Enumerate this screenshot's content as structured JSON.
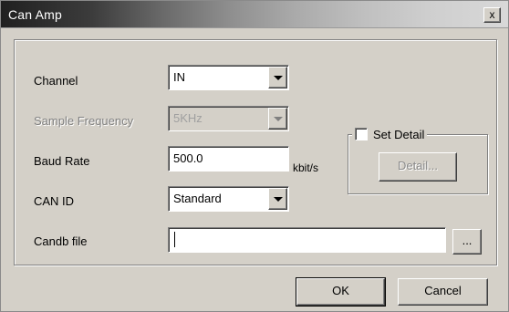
{
  "window": {
    "title": "Can Amp",
    "close_label": "x"
  },
  "form": {
    "channel": {
      "label": "Channel",
      "value": "IN"
    },
    "sample_frequency": {
      "label": "Sample Frequency",
      "value": "5KHz"
    },
    "baud_rate": {
      "label": "Baud Rate",
      "value": "500.0",
      "unit": "kbit/s"
    },
    "can_id": {
      "label": "CAN ID",
      "value": "Standard"
    },
    "candb_file": {
      "label": "Candb file",
      "value": "",
      "browse_label": "..."
    }
  },
  "set_detail": {
    "checkbox_label": "Set Detail",
    "checked": false,
    "detail_button_label": "Detail..."
  },
  "footer": {
    "ok_label": "OK",
    "cancel_label": "Cancel"
  }
}
